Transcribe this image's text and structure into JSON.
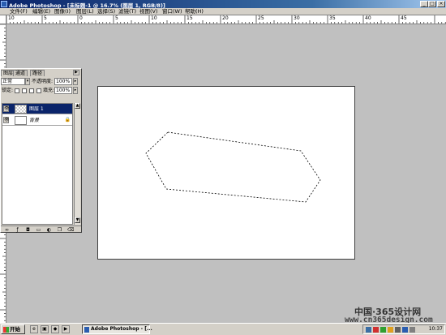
{
  "window": {
    "title": "Adobe Photoshop - [未标题-1 @ 16.7% (图层 1, RGB/8)]",
    "minimize": "_",
    "maximize": "□",
    "close": "×"
  },
  "menu": {
    "items": [
      "文件(F)",
      "编辑(E)",
      "图像(I)",
      "图层(L)",
      "选择(S)",
      "滤镜(T)",
      "视图(V)",
      "窗口(W)",
      "帮助(H)"
    ]
  },
  "ruler": {
    "top_labels": [
      "10",
      "5",
      "0",
      "5",
      "10",
      "15",
      "20",
      "25",
      "30",
      "35",
      "40",
      "45"
    ]
  },
  "layers_panel": {
    "tabs": [
      "图层",
      "通道",
      "路径"
    ],
    "blend_mode": "正常",
    "opacity_label": "不透明度:",
    "opacity_value": "100%",
    "lock_label": "锁定:",
    "fill_label": "填充:",
    "fill_value": "100%",
    "layers": [
      {
        "name": "图层 1",
        "selected": true,
        "thumbnail": "transparent-checker"
      },
      {
        "name": "背景",
        "selected": false,
        "thumbnail": "white",
        "locked": true
      }
    ],
    "footer_icons": [
      "link-icon",
      "layer-style-icon",
      "mask-icon",
      "folder-icon",
      "adjustment-icon",
      "new-layer-icon",
      "trash-icon"
    ]
  },
  "document": {
    "selection_shape": "dashed-hexagon-marquee"
  },
  "taskbar": {
    "start_label": "开始",
    "task_label": "Adobe Photoshop - [...",
    "clock": "10:37"
  },
  "watermark": {
    "line1": "中国·365设计网",
    "line2": "www.cn365design.com"
  },
  "colors": {
    "titlebar": "#0a246a",
    "workspace": "#c0c0c0",
    "chrome": "#d4d0c8",
    "selected_layer": "#0a246a"
  }
}
